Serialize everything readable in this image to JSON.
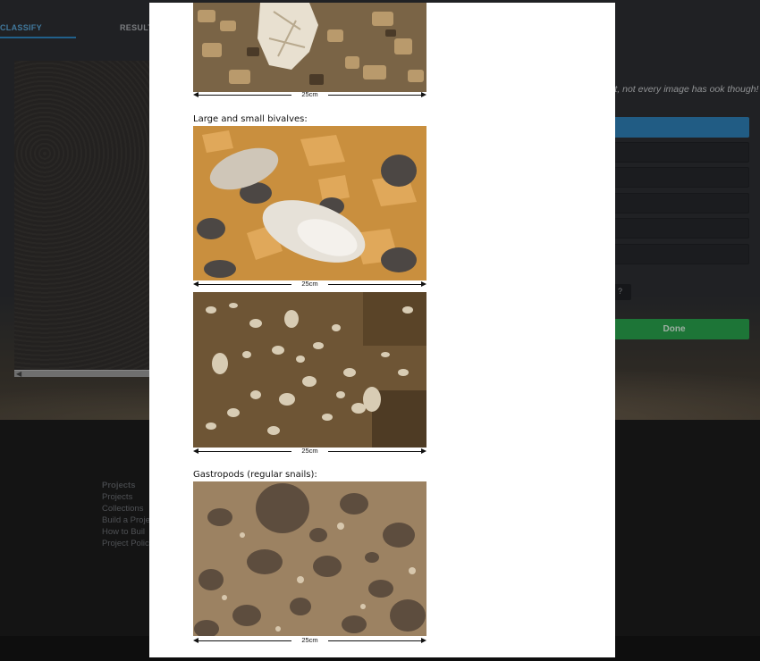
{
  "app": {
    "tabs": [
      {
        "label": "CLASSIFY"
      },
      {
        "label": "RESULT"
      }
    ],
    "task": {
      "question_text": "d to spot, not every image has ook though!",
      "done_label": "Done",
      "help_label": "?"
    },
    "footer": {
      "heading": "Projects",
      "links": [
        "Projects",
        "Collections",
        "Build a Proje",
        "How to Buil",
        "Project Polic"
      ]
    }
  },
  "modal": {
    "sections": [
      {
        "caption": "",
        "scale": "25cm"
      },
      {
        "caption": "Large and small bivalves:",
        "scale": "25cm"
      },
      {
        "caption": "",
        "scale": "25cm"
      },
      {
        "caption": "Gastropods (regular snails):",
        "scale": "25cm"
      }
    ]
  }
}
